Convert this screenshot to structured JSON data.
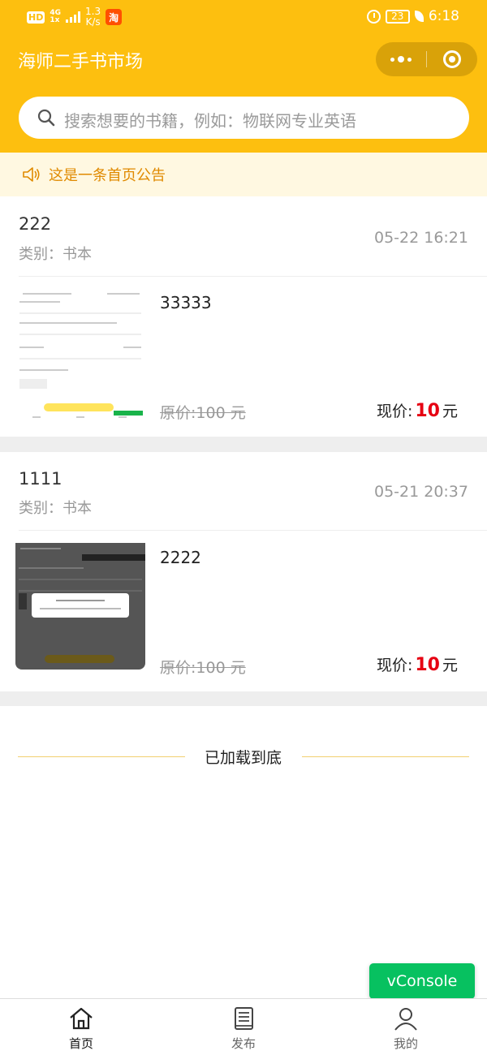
{
  "status_bar": {
    "hd": "HD",
    "network_top": "4G",
    "network_bottom": "1x",
    "speed_top": "1.3",
    "speed_bottom": "K/s",
    "app_badge": "淘",
    "battery": "23",
    "time": "6:18"
  },
  "nav": {
    "title": "海师二手书市场"
  },
  "search": {
    "placeholder": "搜索想要的书籍，例如：物联网专业英语"
  },
  "notice": {
    "text": "这是一条首页公告"
  },
  "books": [
    {
      "title": "222",
      "category": "类别：书本",
      "time": "05-22 16:21",
      "name": "33333",
      "original_price": "原价:100 元",
      "current_price_label": "现价:",
      "current_price_value": "10",
      "current_price_unit": "元"
    },
    {
      "title": "1111",
      "category": "类别：书本",
      "time": "05-21 20:37",
      "name": "2222",
      "original_price": "原价:100 元",
      "current_price_label": "现价:",
      "current_price_value": "10",
      "current_price_unit": "元"
    }
  ],
  "footer": {
    "end_text": "已加载到底"
  },
  "vconsole": {
    "label": "vConsole"
  },
  "tabbar": {
    "items": [
      {
        "label": "首页",
        "icon": "home-icon",
        "active": true
      },
      {
        "label": "发布",
        "icon": "book-icon",
        "active": false
      },
      {
        "label": "我的",
        "icon": "user-icon",
        "active": false
      }
    ]
  },
  "colors": {
    "brand": "#FDBF0F",
    "price": "#E60012",
    "notice_text": "#E08A00",
    "vconsole": "#07C160"
  }
}
